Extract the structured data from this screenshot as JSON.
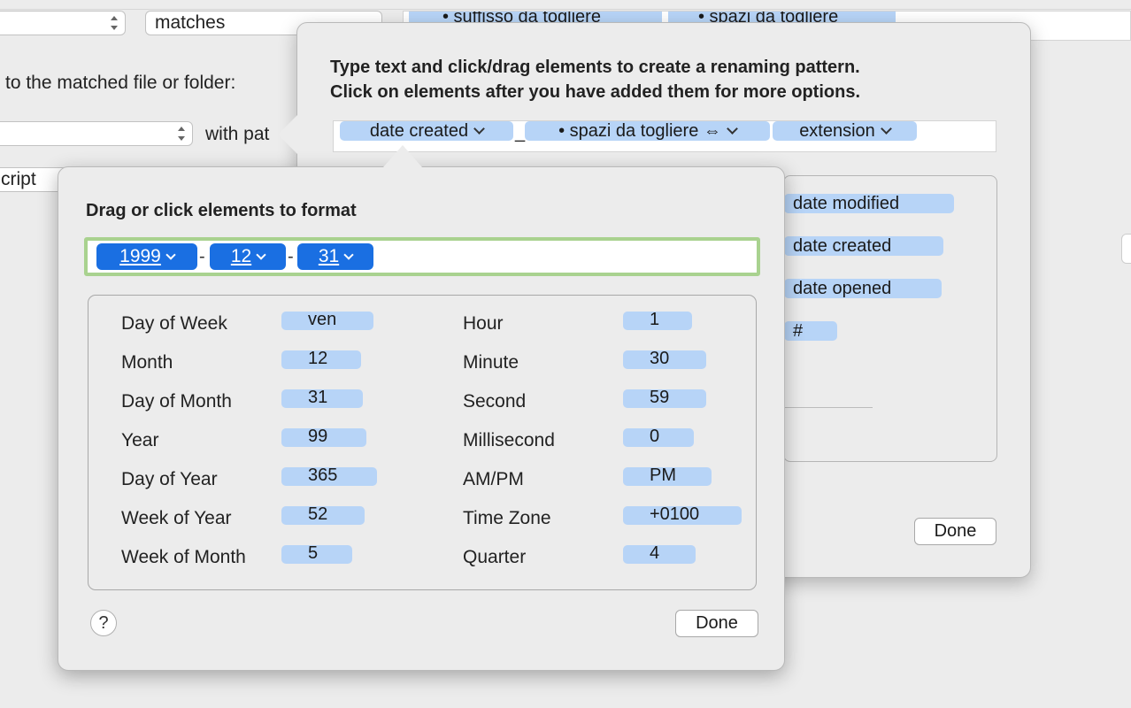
{
  "background": {
    "matches_select": "matches",
    "token_suffisso": "• suffisso da togliere",
    "token_spazi": "• spazi da togliere",
    "label_matched": "to the matched file or folder:",
    "label_with_pattern": "with pat",
    "label_script": "cript"
  },
  "rename_popover": {
    "instruction_line1": "Type text and click/drag elements to create a renaming pattern.",
    "instruction_line2": "Click on elements after you have added them for more options.",
    "pattern_tokens": [
      "date created",
      "• spazi da togliere ⇔",
      "extension"
    ],
    "pattern_separator": "_",
    "elements": [
      "date modified",
      "date created",
      "date opened",
      "#"
    ],
    "done_label": "Done"
  },
  "format_popover": {
    "title": "Drag or click elements to format",
    "format_tokens": [
      "1999",
      "12",
      "31"
    ],
    "separators": [
      "-",
      "-"
    ],
    "left_column": [
      {
        "label": "Day of Week",
        "sample": "ven"
      },
      {
        "label": "Month",
        "sample": "12"
      },
      {
        "label": "Day of Month",
        "sample": "31"
      },
      {
        "label": "Year",
        "sample": "99"
      },
      {
        "label": "Day of Year",
        "sample": "365"
      },
      {
        "label": "Week of Year",
        "sample": "52"
      },
      {
        "label": "Week of Month",
        "sample": "5"
      }
    ],
    "right_column": [
      {
        "label": "Hour",
        "sample": "1"
      },
      {
        "label": "Minute",
        "sample": "30"
      },
      {
        "label": "Second",
        "sample": "59"
      },
      {
        "label": "Millisecond",
        "sample": "0"
      },
      {
        "label": "AM/PM",
        "sample": "PM"
      },
      {
        "label": "Time Zone",
        "sample": "+0100"
      },
      {
        "label": "Quarter",
        "sample": "4"
      }
    ],
    "help_label": "?",
    "done_label": "Done"
  }
}
